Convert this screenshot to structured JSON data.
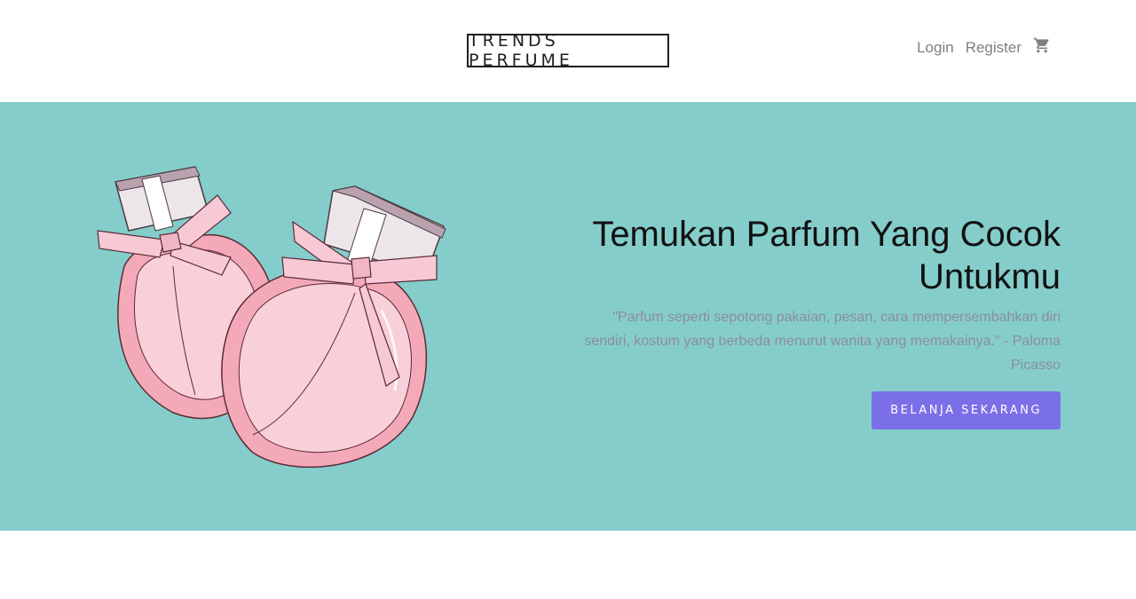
{
  "header": {
    "logo": "TRENDS PERFUME",
    "nav": {
      "login": "Login",
      "register": "Register"
    },
    "cart_icon": "cart-icon"
  },
  "hero": {
    "title": "Temukan Parfum Yang Cocok Untukmu",
    "quote": "\"Parfum seperti sepotong pakaian, pesan, cara mempersembahkan diri sendiri, kostum yang berbeda menurut wanita yang memakainya.\" - Paloma Picasso",
    "cta_label": "BELANJA SEKARANG",
    "image": "perfume-bottles-illustration"
  },
  "colors": {
    "hero_bg": "#84cdcb",
    "cta_bg": "#7b6fe8",
    "title": "#111111",
    "quote": "#8d8d9c",
    "nav": "#7f7f7f"
  }
}
